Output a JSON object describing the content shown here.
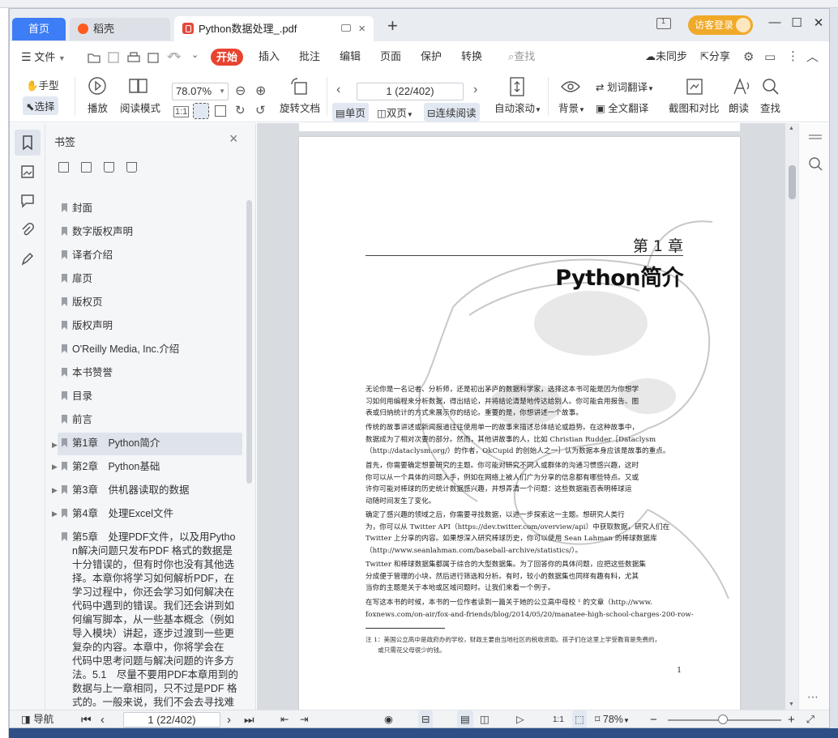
{
  "tabs": {
    "home": "首页",
    "daoke": "稻壳",
    "document": "Python数据处理_.pdf",
    "new_tab": "+"
  },
  "titlebar": {
    "login_label": "访客登录",
    "minimize": "—",
    "maximize": "☐",
    "close": "✕",
    "options_label": "1"
  },
  "menu": {
    "file": "文件",
    "start": "开始",
    "insert": "插入",
    "annotate": "批注",
    "edit": "编辑",
    "page": "页面",
    "protect": "保护",
    "convert": "转换",
    "search_placeholder": "查找",
    "sync": "未同步",
    "share": "分享"
  },
  "toolbar": {
    "hand": "手型",
    "select": "选择",
    "play": "播放",
    "read_mode": "阅读模式",
    "zoom_value": "78.07%",
    "rotate_doc": "旋转文档",
    "page_field": "1 (22/402)",
    "single_page": "单页",
    "double_page": "双页",
    "continuous": "连续阅读",
    "auto_scroll": "自动滚动",
    "background": "背景",
    "word_translate": "划词翻译",
    "full_translate": "全文翻译",
    "crop_compare": "截图和对比",
    "read_aloud": "朗读",
    "find": "查找"
  },
  "bookmarks": {
    "title": "书签",
    "items": [
      {
        "label": "封面"
      },
      {
        "label": "数字版权声明"
      },
      {
        "label": "译者介绍"
      },
      {
        "label": "扉页"
      },
      {
        "label": "版权页"
      },
      {
        "label": "版权声明"
      },
      {
        "label": "O'Reilly Media, Inc.介绍"
      },
      {
        "label": "本书赞誉"
      },
      {
        "label": "目录"
      },
      {
        "label": "前言"
      },
      {
        "label": "第1章　Python简介"
      },
      {
        "label": "第2章　Python基础"
      },
      {
        "label": "第3章　供机器读取的数据"
      },
      {
        "label": "第4章　处理Excel文件"
      }
    ],
    "chapter5_lines": [
      "第5章　处理PDF文件，以及用Pytho",
      "n解决问题只发布PDF 格式的数据是",
      "十分错误的，但有时你也没有其他选",
      "择。本章你将学习如何解析PDF，在",
      "学习过程中，你还会学习如何解决在",
      "代码中遇到的错误。我们还会讲到如",
      "何编写脚本，从一些基本概念（例如",
      "导入模块）讲起，逐步过渡到一些更",
      "复杂的内容。本章中，你将学会在",
      "代码中思考问题与解决问题的许多方",
      "法。5.1　尽量不要用PDF本章用到的",
      "数据与上一章相同，只不过是PDF 格",
      "式的。一般来说，我们不会去寻找难",
      "以解析的数据格式，但我们有时必须"
    ]
  },
  "page": {
    "chapter_label": "第 1 章",
    "title": "Python简介",
    "paragraphs": [
      [
        "无论你是一名记者、分析师，还是初出茅庐的数据科学家，选择这本书可能是因为你想学",
        "习如何用编程来分析数据，得出结论，并将结论清楚地传达给别人。你可能会用报告、图",
        "表或归纳统计的方式来展示你的结论。重要的是，你想讲述一个故事。"
      ],
      [
        "传统的故事讲述或新闻报道往往使用单一的故事来描述总体结论或趋势。在这种故事中，",
        "数据成为了相对次要的部分。然而，其他讲故事的人，比如 Christian Rudder［Dataclysm",
        "（http://dataclysm.org/）的作者，OkCupid 的创始人之一］认为数据本身应该是故事的重点。"
      ],
      [
        "首先，你需要确定想要研究的主题。你可能对研究不同人或群体的沟通习惯感兴趣，这时",
        "你可以从一个具体的问题入手，例如在网络上被人们广为分享的信息都有哪些特点。又或",
        "许你可能对棒球的历史统计数据感兴趣，并想弄清一个问题：这些数据能否表明棒球运",
        "动随时间发生了变化。"
      ],
      [
        "确定了感兴趣的领域之后，你需要寻找数据，以进一步探索这一主题。想研究人类行",
        "为，你可以从 Twitter API（https://dev.twitter.com/overview/api）中获取数据，研究人们在",
        "Twitter 上分享的内容。如果想深入研究棒球历史，你可以使用 Sean Lahman 的棒球数据库",
        "（http://www.seanlahman.com/baseball-archive/statistics/）。"
      ],
      [
        "Twitter 和棒球数据集都属于综合的大型数据集。为了回答你的具体问题，应把这些数据集",
        "分成便于管理的小块，然后进行筛选和分析。有时，较小的数据集也同样有趣有料，尤其",
        "当你的主题是关于本地或区域问题时。让我们来看一个例子。"
      ],
      [
        "在写这本书的时候，本书的一位作者读到一篇关于她的公立高中母校 ¹ 的文章（http://www.",
        "foxnews.com/on-air/fox-and-friends/blog/2014/05/20/manatee-high-school-charges-200-row-"
      ]
    ],
    "footnote": [
      "注 1：美国公立高中是政府办的学校，财政主要由当地社区的税收资助。孩子们在这里上学受教育是免费的，",
      "　　或只需花父母很少的钱。"
    ],
    "page_number": "1"
  },
  "statusbar": {
    "nav": "导航",
    "page_field": "1 (22/402)",
    "zoom": "78%",
    "fit_label": "1:1"
  },
  "colors": {
    "accent": "#3d7df5",
    "start_tab": "#e8432f",
    "login": "#f0a928"
  }
}
